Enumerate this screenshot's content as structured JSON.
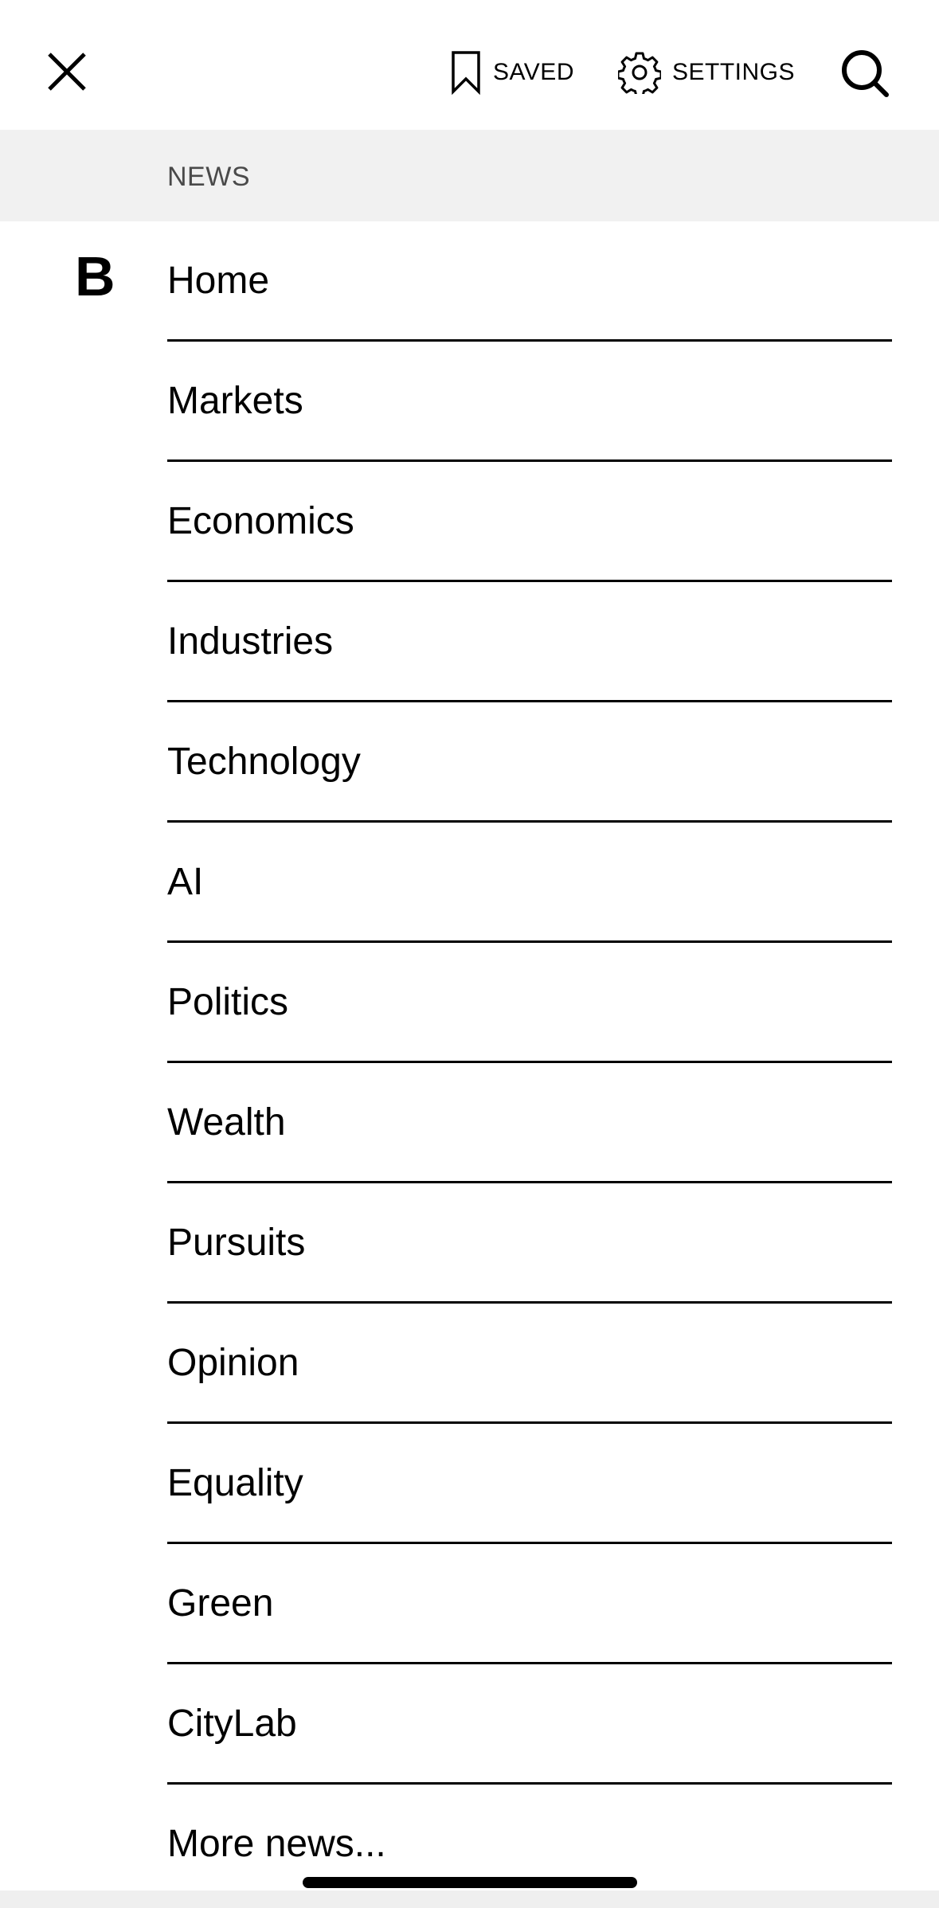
{
  "header": {
    "saved_label": "SAVED",
    "settings_label": "SETTINGS"
  },
  "section": {
    "title": "NEWS"
  },
  "logo": {
    "letter": "B"
  },
  "nav": {
    "items": [
      {
        "label": "Home"
      },
      {
        "label": "Markets"
      },
      {
        "label": "Economics"
      },
      {
        "label": "Industries"
      },
      {
        "label": "Technology"
      },
      {
        "label": "AI"
      },
      {
        "label": "Politics"
      },
      {
        "label": "Wealth"
      },
      {
        "label": "Pursuits"
      },
      {
        "label": "Opinion"
      },
      {
        "label": "Equality"
      },
      {
        "label": "Green"
      },
      {
        "label": "CityLab"
      },
      {
        "label": "More news..."
      }
    ]
  },
  "icons": {
    "close": "close-icon",
    "saved": "bookmark-icon",
    "settings": "gear-icon",
    "search": "search-icon"
  },
  "colors": {
    "text": "#000000",
    "section_bg": "#f1f1f1",
    "section_text": "#4a4a4a",
    "divider": "#000000"
  }
}
